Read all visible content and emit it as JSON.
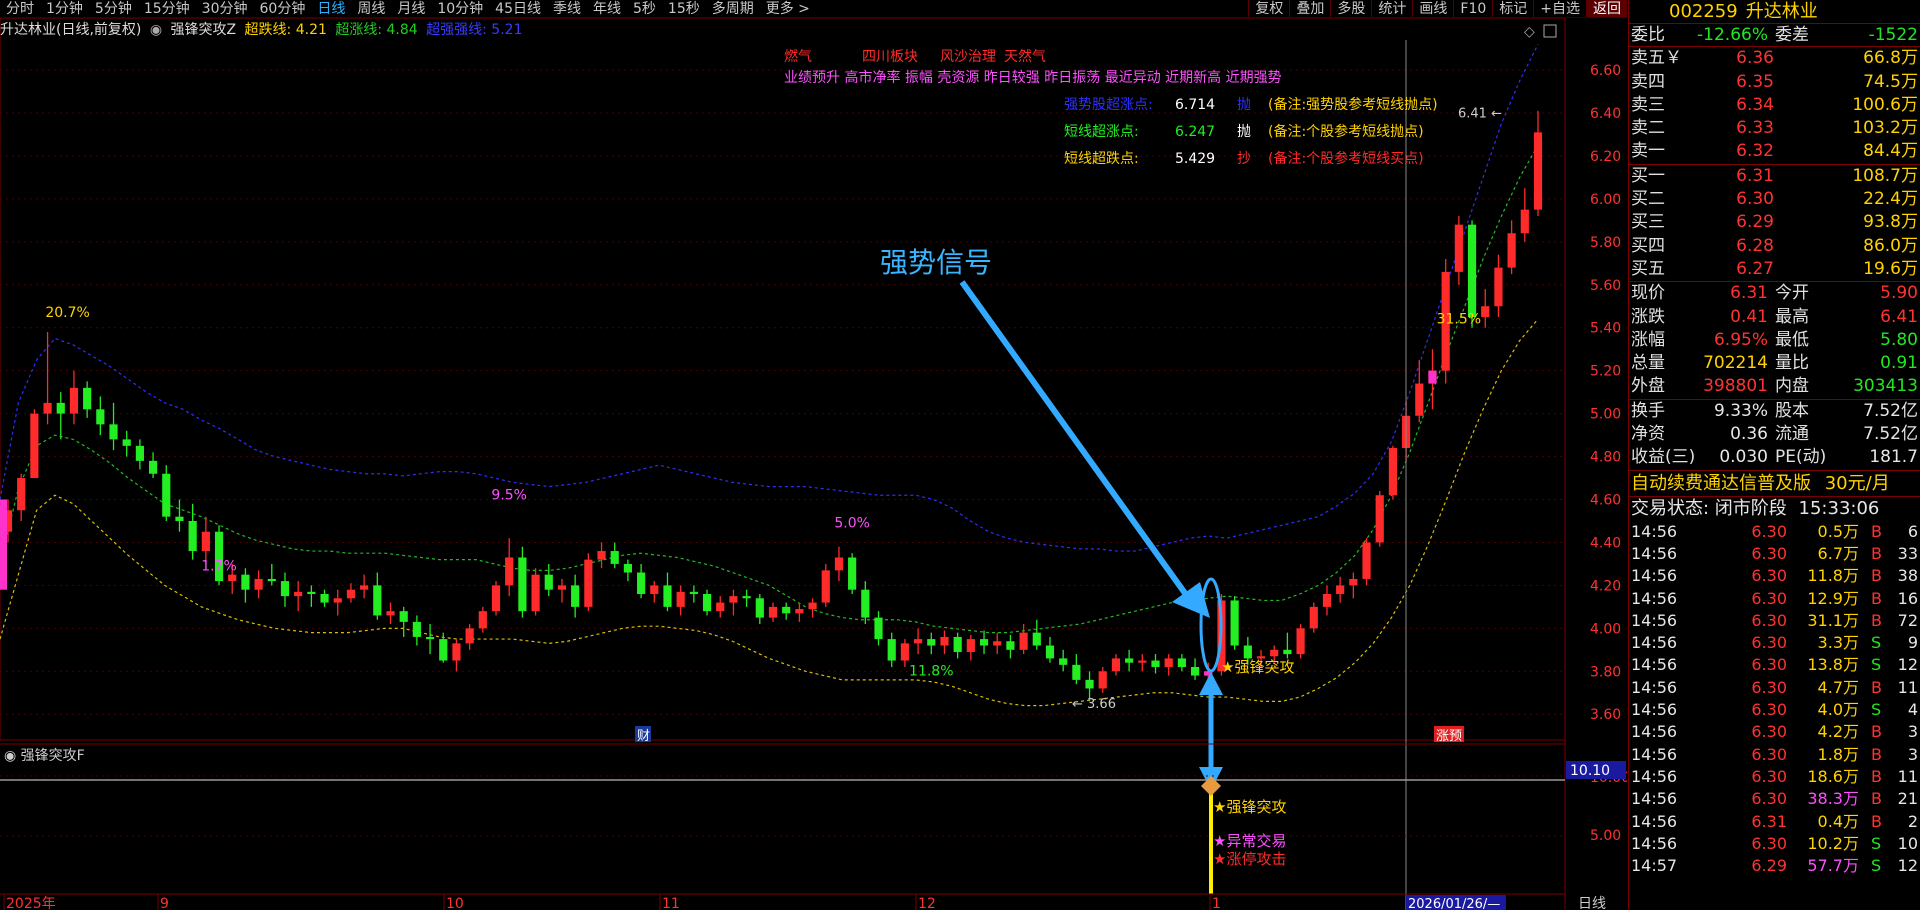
{
  "toolbar": {
    "periods": [
      "分时",
      "1分钟",
      "5分钟",
      "15分钟",
      "30分钟",
      "60分钟",
      "日线",
      "周线",
      "月线",
      "10分钟",
      "45日线",
      "季线",
      "年线",
      "5秒",
      "15秒",
      "多周期",
      "更多 >"
    ],
    "active_period": "日线",
    "right": [
      "复权",
      "叠加",
      "多股",
      "统计",
      "画线",
      "F10",
      "标记",
      "+自选",
      "返回"
    ]
  },
  "indicator_line": {
    "stock": "升达林业(日线,前复权)",
    "indicator": "强锋突攻Z",
    "chaodie": "超跌线: 4.21",
    "chaozhang": "超涨线: 4.84",
    "chaoqiang": "超强强线: 5.21"
  },
  "annotations": {
    "concepts_red": [
      "燃气",
      "四川板块",
      "风沙治理",
      "天然气"
    ],
    "concepts_magenta": "业绩预升 高市净率 振幅 壳资源 昨日较强 昨日振荡 最近异动 近期新高 近期强势",
    "signals": [
      {
        "label": "强势股超涨点:",
        "value": "6.714",
        "action": "抛",
        "note": "(备注:强势股参考短线抛点)"
      },
      {
        "label": "短线超涨点:",
        "value": "6.247",
        "action": "抛",
        "note": "(备注:个股参考短线抛点)"
      },
      {
        "label": "短线超跌点:",
        "value": "5.429",
        "action": "抄",
        "note": "(备注:个股参考短线买点)"
      }
    ],
    "big_label": "强势信号",
    "signal_tag": "强锋突攻",
    "pct_labels": [
      "20.7%",
      "1.7%",
      "9.5%",
      "5.0%",
      "11.8%",
      "31.5%"
    ],
    "low_label": "3.66",
    "high_label": "6.41",
    "cai": "财",
    "zhangting_tag": "涨预",
    "sub_signals": [
      "强锋突攻",
      "异常交易",
      "涨停攻击"
    ]
  },
  "sub_chart": {
    "title": "强锋突攻F",
    "tick_5": "5.00",
    "tick_10": "10.00",
    "marker": "10.10"
  },
  "axis": {
    "price_ticks": [
      "6.60",
      "6.40",
      "6.20",
      "6.00",
      "5.80",
      "5.60",
      "5.40",
      "5.20",
      "5.00",
      "4.80",
      "4.60",
      "4.40",
      "4.20",
      "4.00",
      "3.80",
      "3.60"
    ],
    "dates": [
      "2025年",
      "9",
      "10",
      "11",
      "12",
      "1"
    ],
    "cursor_date": "2026/01/26/—",
    "period_label": "日线"
  },
  "chart_data": {
    "type": "candlestick",
    "title": "升达林业(日线,前复权)",
    "ylim": [
      3.48,
      6.74
    ],
    "candles": [
      [
        4.45,
        4.6,
        4.4,
        4.55
      ],
      [
        4.55,
        4.72,
        4.5,
        4.7
      ],
      [
        4.7,
        5.02,
        4.7,
        5.0
      ],
      [
        5.0,
        5.38,
        4.95,
        5.05
      ],
      [
        5.05,
        5.1,
        4.88,
        5.0
      ],
      [
        5.0,
        5.2,
        4.95,
        5.12
      ],
      [
        5.12,
        5.15,
        4.98,
        5.02
      ],
      [
        5.02,
        5.08,
        4.9,
        4.95
      ],
      [
        4.95,
        5.05,
        4.83,
        4.88
      ],
      [
        4.88,
        4.92,
        4.8,
        4.85
      ],
      [
        4.85,
        4.88,
        4.74,
        4.78
      ],
      [
        4.78,
        4.82,
        4.7,
        4.72
      ],
      [
        4.72,
        4.76,
        4.5,
        4.52
      ],
      [
        4.52,
        4.6,
        4.45,
        4.5
      ],
      [
        4.5,
        4.58,
        4.32,
        4.36
      ],
      [
        4.36,
        4.52,
        4.3,
        4.45
      ],
      [
        4.45,
        4.48,
        4.2,
        4.22
      ],
      [
        4.22,
        4.3,
        4.16,
        4.25
      ],
      [
        4.25,
        4.28,
        4.12,
        4.18
      ],
      [
        4.18,
        4.27,
        4.14,
        4.23
      ],
      [
        4.23,
        4.3,
        4.2,
        4.22
      ],
      [
        4.22,
        4.26,
        4.1,
        4.15
      ],
      [
        4.15,
        4.22,
        4.08,
        4.17
      ],
      [
        4.17,
        4.2,
        4.1,
        4.16
      ],
      [
        4.16,
        4.18,
        4.1,
        4.12
      ],
      [
        4.12,
        4.18,
        4.06,
        4.14
      ],
      [
        4.14,
        4.21,
        4.12,
        4.18
      ],
      [
        4.18,
        4.25,
        4.14,
        4.2
      ],
      [
        4.2,
        4.26,
        4.04,
        4.06
      ],
      [
        4.06,
        4.12,
        4.02,
        4.08
      ],
      [
        4.08,
        4.1,
        3.96,
        4.03
      ],
      [
        4.03,
        4.06,
        3.92,
        3.96
      ],
      [
        3.96,
        4.02,
        3.88,
        3.95
      ],
      [
        3.95,
        3.98,
        3.84,
        3.85
      ],
      [
        3.85,
        3.95,
        3.8,
        3.93
      ],
      [
        3.93,
        4.02,
        3.9,
        4.0
      ],
      [
        4.0,
        4.1,
        3.98,
        4.08
      ],
      [
        4.08,
        4.22,
        4.06,
        4.2
      ],
      [
        4.2,
        4.42,
        4.15,
        4.33
      ],
      [
        4.33,
        4.38,
        4.05,
        4.08
      ],
      [
        4.08,
        4.28,
        4.06,
        4.25
      ],
      [
        4.25,
        4.3,
        4.15,
        4.18
      ],
      [
        4.18,
        4.23,
        4.12,
        4.2
      ],
      [
        4.2,
        4.25,
        4.05,
        4.1
      ],
      [
        4.1,
        4.35,
        4.08,
        4.32
      ],
      [
        4.32,
        4.4,
        4.28,
        4.36
      ],
      [
        4.36,
        4.4,
        4.28,
        4.3
      ],
      [
        4.3,
        4.32,
        4.22,
        4.26
      ],
      [
        4.26,
        4.3,
        4.14,
        4.16
      ],
      [
        4.16,
        4.22,
        4.12,
        4.2
      ],
      [
        4.2,
        4.26,
        4.08,
        4.1
      ],
      [
        4.1,
        4.2,
        4.06,
        4.17
      ],
      [
        4.17,
        4.2,
        4.12,
        4.16
      ],
      [
        4.16,
        4.18,
        4.06,
        4.08
      ],
      [
        4.08,
        4.15,
        4.05,
        4.12
      ],
      [
        4.12,
        4.18,
        4.06,
        4.15
      ],
      [
        4.15,
        4.18,
        4.1,
        4.14
      ],
      [
        4.14,
        4.16,
        4.02,
        4.05
      ],
      [
        4.05,
        4.12,
        4.03,
        4.1
      ],
      [
        4.1,
        4.12,
        4.04,
        4.07
      ],
      [
        4.07,
        4.12,
        4.03,
        4.09
      ],
      [
        4.09,
        4.14,
        4.05,
        4.12
      ],
      [
        4.12,
        4.3,
        4.1,
        4.27
      ],
      [
        4.27,
        4.38,
        4.22,
        4.33
      ],
      [
        4.33,
        4.35,
        4.16,
        4.18
      ],
      [
        4.18,
        4.22,
        4.02,
        4.05
      ],
      [
        4.05,
        4.08,
        3.92,
        3.95
      ],
      [
        3.95,
        3.98,
        3.82,
        3.85
      ],
      [
        3.85,
        3.95,
        3.82,
        3.93
      ],
      [
        3.93,
        4.0,
        3.88,
        3.95
      ],
      [
        3.95,
        3.98,
        3.88,
        3.92
      ],
      [
        3.92,
        3.99,
        3.88,
        3.96
      ],
      [
        3.96,
        3.98,
        3.86,
        3.89
      ],
      [
        3.89,
        3.97,
        3.85,
        3.95
      ],
      [
        3.95,
        3.99,
        3.88,
        3.92
      ],
      [
        3.92,
        3.98,
        3.88,
        3.94
      ],
      [
        3.94,
        3.97,
        3.86,
        3.9
      ],
      [
        3.9,
        4.02,
        3.88,
        3.98
      ],
      [
        3.98,
        4.04,
        3.9,
        3.92
      ],
      [
        3.92,
        3.96,
        3.84,
        3.86
      ],
      [
        3.86,
        3.9,
        3.8,
        3.83
      ],
      [
        3.83,
        3.88,
        3.74,
        3.76
      ],
      [
        3.76,
        3.8,
        3.66,
        3.72
      ],
      [
        3.72,
        3.82,
        3.7,
        3.8
      ],
      [
        3.8,
        3.88,
        3.78,
        3.86
      ],
      [
        3.86,
        3.9,
        3.8,
        3.84
      ],
      [
        3.84,
        3.88,
        3.8,
        3.85
      ],
      [
        3.85,
        3.88,
        3.79,
        3.82
      ],
      [
        3.82,
        3.88,
        3.78,
        3.86
      ],
      [
        3.86,
        3.88,
        3.8,
        3.82
      ],
      [
        3.82,
        3.86,
        3.76,
        3.78
      ],
      [
        3.78,
        3.84,
        3.74,
        3.8
      ],
      [
        3.8,
        4.16,
        3.78,
        4.13
      ],
      [
        4.13,
        4.15,
        3.9,
        3.92
      ],
      [
        3.92,
        3.96,
        3.83,
        3.86
      ],
      [
        3.86,
        3.9,
        3.82,
        3.87
      ],
      [
        3.87,
        3.92,
        3.84,
        3.9
      ],
      [
        3.9,
        3.98,
        3.86,
        3.88
      ],
      [
        3.88,
        4.02,
        3.86,
        4.0
      ],
      [
        4.0,
        4.12,
        3.98,
        4.1
      ],
      [
        4.1,
        4.2,
        4.06,
        4.16
      ],
      [
        4.16,
        4.24,
        4.12,
        4.2
      ],
      [
        4.2,
        4.26,
        4.14,
        4.23
      ],
      [
        4.23,
        4.42,
        4.2,
        4.4
      ],
      [
        4.4,
        4.64,
        4.38,
        4.62
      ],
      [
        4.62,
        4.85,
        4.6,
        4.84
      ],
      [
        4.84,
        5.06,
        4.78,
        4.99
      ],
      [
        4.99,
        5.25,
        4.96,
        5.14
      ],
      [
        5.14,
        5.3,
        5.02,
        5.2
      ],
      [
        5.2,
        5.72,
        5.14,
        5.66
      ],
      [
        5.66,
        5.92,
        5.6,
        5.88
      ],
      [
        5.88,
        5.9,
        5.4,
        5.45
      ],
      [
        5.45,
        5.58,
        5.4,
        5.5
      ],
      [
        5.5,
        5.74,
        5.45,
        5.68
      ],
      [
        5.68,
        5.9,
        5.65,
        5.84
      ],
      [
        5.84,
        6.05,
        5.8,
        5.95
      ],
      [
        5.95,
        6.41,
        5.92,
        6.31
      ]
    ],
    "bands": {
      "upper": [
        4.6,
        5.05,
        5.25,
        5.35,
        5.32,
        5.27,
        5.22,
        5.16,
        5.1,
        5.05,
        5.02,
        4.97,
        4.93,
        4.88,
        4.83,
        4.8,
        4.78,
        4.76,
        4.74,
        4.73,
        4.72,
        4.72,
        4.71,
        4.72,
        4.73,
        4.73,
        4.72,
        4.7,
        4.68,
        4.67,
        4.66,
        4.67,
        4.68,
        4.7,
        4.72,
        4.74,
        4.76,
        4.74,
        4.72,
        4.7,
        4.68,
        4.67,
        4.66,
        4.66,
        4.66,
        4.65,
        4.64,
        4.63,
        4.62,
        4.62,
        4.62,
        4.6,
        4.56,
        4.5,
        4.45,
        4.42,
        4.4,
        4.39,
        4.38,
        4.37,
        4.37,
        4.36,
        4.36,
        4.38,
        4.4,
        4.42,
        4.43,
        4.42,
        4.44,
        4.46,
        4.48,
        4.5,
        4.52,
        4.57,
        4.63,
        4.72,
        4.87,
        5.1,
        5.35,
        5.6,
        5.85,
        6.1,
        6.35,
        6.55,
        6.72
      ],
      "mid": [
        4.3,
        4.65,
        4.85,
        4.9,
        4.88,
        4.83,
        4.77,
        4.7,
        4.64,
        4.58,
        4.55,
        4.52,
        4.48,
        4.44,
        4.41,
        4.39,
        4.37,
        4.36,
        4.36,
        4.35,
        4.35,
        4.35,
        4.34,
        4.33,
        4.32,
        4.32,
        4.32,
        4.3,
        4.28,
        4.27,
        4.27,
        4.28,
        4.3,
        4.32,
        4.34,
        4.35,
        4.34,
        4.33,
        4.31,
        4.29,
        4.26,
        4.23,
        4.2,
        4.15,
        4.1,
        4.07,
        4.05,
        4.04,
        4.04,
        4.04,
        4.03,
        4.01,
        4.0,
        3.99,
        3.98,
        3.98,
        3.99,
        4.0,
        4.01,
        4.02,
        4.04,
        4.06,
        4.08,
        4.1,
        4.12,
        4.13,
        4.14,
        4.15,
        4.14,
        4.13,
        4.13,
        4.16,
        4.2,
        4.26,
        4.34,
        4.46,
        4.62,
        4.82,
        5.05,
        5.28,
        5.5,
        5.72,
        5.92,
        6.1,
        6.25
      ],
      "lower": [
        3.95,
        4.25,
        4.55,
        4.62,
        4.58,
        4.5,
        4.42,
        4.34,
        4.27,
        4.2,
        4.15,
        4.1,
        4.07,
        4.04,
        4.02,
        4.0,
        3.99,
        3.98,
        3.98,
        3.98,
        3.99,
        4.0,
        4.0,
        3.98,
        3.96,
        3.95,
        3.95,
        3.95,
        3.95,
        3.94,
        3.93,
        3.94,
        3.96,
        3.98,
        4.0,
        4.01,
        4.01,
        4.0,
        3.99,
        3.97,
        3.94,
        3.9,
        3.86,
        3.83,
        3.8,
        3.78,
        3.76,
        3.76,
        3.76,
        3.76,
        3.76,
        3.75,
        3.73,
        3.7,
        3.67,
        3.65,
        3.64,
        3.64,
        3.65,
        3.66,
        3.67,
        3.68,
        3.69,
        3.7,
        3.7,
        3.69,
        3.68,
        3.68,
        3.67,
        3.66,
        3.66,
        3.68,
        3.72,
        3.77,
        3.84,
        3.93,
        4.05,
        4.2,
        4.39,
        4.6,
        4.82,
        5.02,
        5.2,
        5.34,
        5.44
      ]
    }
  },
  "right_panel": {
    "code": "002259",
    "name": "升达林业",
    "weibi": {
      "label": "委比",
      "value": "-12.66%",
      "label2": "委差",
      "value2": "-1522"
    },
    "asks": [
      {
        "label": "卖五￥",
        "price": "6.36",
        "vol": "66.8万"
      },
      {
        "label": "卖四",
        "price": "6.35",
        "vol": "74.5万"
      },
      {
        "label": "卖三",
        "price": "6.34",
        "vol": "100.6万"
      },
      {
        "label": "卖二",
        "price": "6.33",
        "vol": "103.2万"
      },
      {
        "label": "卖一",
        "price": "6.32",
        "vol": "84.4万"
      }
    ],
    "bids": [
      {
        "label": "买一",
        "price": "6.31",
        "vol": "108.7万"
      },
      {
        "label": "买二",
        "price": "6.30",
        "vol": "22.4万"
      },
      {
        "label": "买三",
        "price": "6.29",
        "vol": "93.8万"
      },
      {
        "label": "买四",
        "price": "6.28",
        "vol": "86.0万"
      },
      {
        "label": "买五",
        "price": "6.27",
        "vol": "19.6万"
      }
    ],
    "quote": [
      {
        "l1": "现价",
        "v1": "6.31",
        "c1": "red",
        "l2": "今开",
        "v2": "5.90",
        "c2": "red"
      },
      {
        "l1": "涨跌",
        "v1": "0.41",
        "c1": "red",
        "l2": "最高",
        "v2": "6.41",
        "c2": "red"
      },
      {
        "l1": "涨幅",
        "v1": "6.95%",
        "c1": "red",
        "l2": "最低",
        "v2": "5.80",
        "c2": "grn"
      },
      {
        "l1": "总量",
        "v1": "702214",
        "c1": "yel",
        "l2": "量比",
        "v2": "0.91",
        "c2": "grn"
      },
      {
        "l1": "外盘",
        "v1": "398801",
        "c1": "red",
        "l2": "内盘",
        "v2": "303413",
        "c2": "grn"
      }
    ],
    "fund": [
      {
        "l1": "换手",
        "v1": "9.33%",
        "l2": "股本",
        "v2": "7.52亿"
      },
      {
        "l1": "净资",
        "v1": "0.36",
        "l2": "流通",
        "v2": "7.52亿"
      },
      {
        "l1": "收益(三)",
        "v1": "0.030",
        "l2": "PE(动)",
        "v2": "181.7"
      }
    ],
    "promo": "自动续费通达信普及版",
    "promo_price": "30元/月",
    "status": "交易状态: 闭市阶段",
    "status_time": "15:33:06",
    "ticks": [
      [
        "14:56",
        "6.30",
        "0.5万",
        "B",
        "6"
      ],
      [
        "14:56",
        "6.30",
        "6.7万",
        "B",
        "33"
      ],
      [
        "14:56",
        "6.30",
        "11.8万",
        "B",
        "38"
      ],
      [
        "14:56",
        "6.30",
        "12.9万",
        "B",
        "16"
      ],
      [
        "14:56",
        "6.30",
        "31.1万",
        "B",
        "72"
      ],
      [
        "14:56",
        "6.30",
        "3.3万",
        "S",
        "9"
      ],
      [
        "14:56",
        "6.30",
        "13.8万",
        "S",
        "12"
      ],
      [
        "14:56",
        "6.30",
        "4.7万",
        "B",
        "11"
      ],
      [
        "14:56",
        "6.30",
        "4.0万",
        "S",
        "4"
      ],
      [
        "14:56",
        "6.30",
        "4.2万",
        "B",
        "3"
      ],
      [
        "14:56",
        "6.30",
        "1.8万",
        "B",
        "3"
      ],
      [
        "14:56",
        "6.30",
        "18.6万",
        "B",
        "11"
      ],
      [
        "14:56",
        "6.30",
        "38.3万",
        "B",
        "21"
      ],
      [
        "14:56",
        "6.31",
        "0.4万",
        "B",
        "2"
      ],
      [
        "14:56",
        "6.30",
        "10.2万",
        "S",
        "10"
      ],
      [
        "14:57",
        "6.29",
        "57.7万",
        "S",
        "12"
      ]
    ]
  }
}
